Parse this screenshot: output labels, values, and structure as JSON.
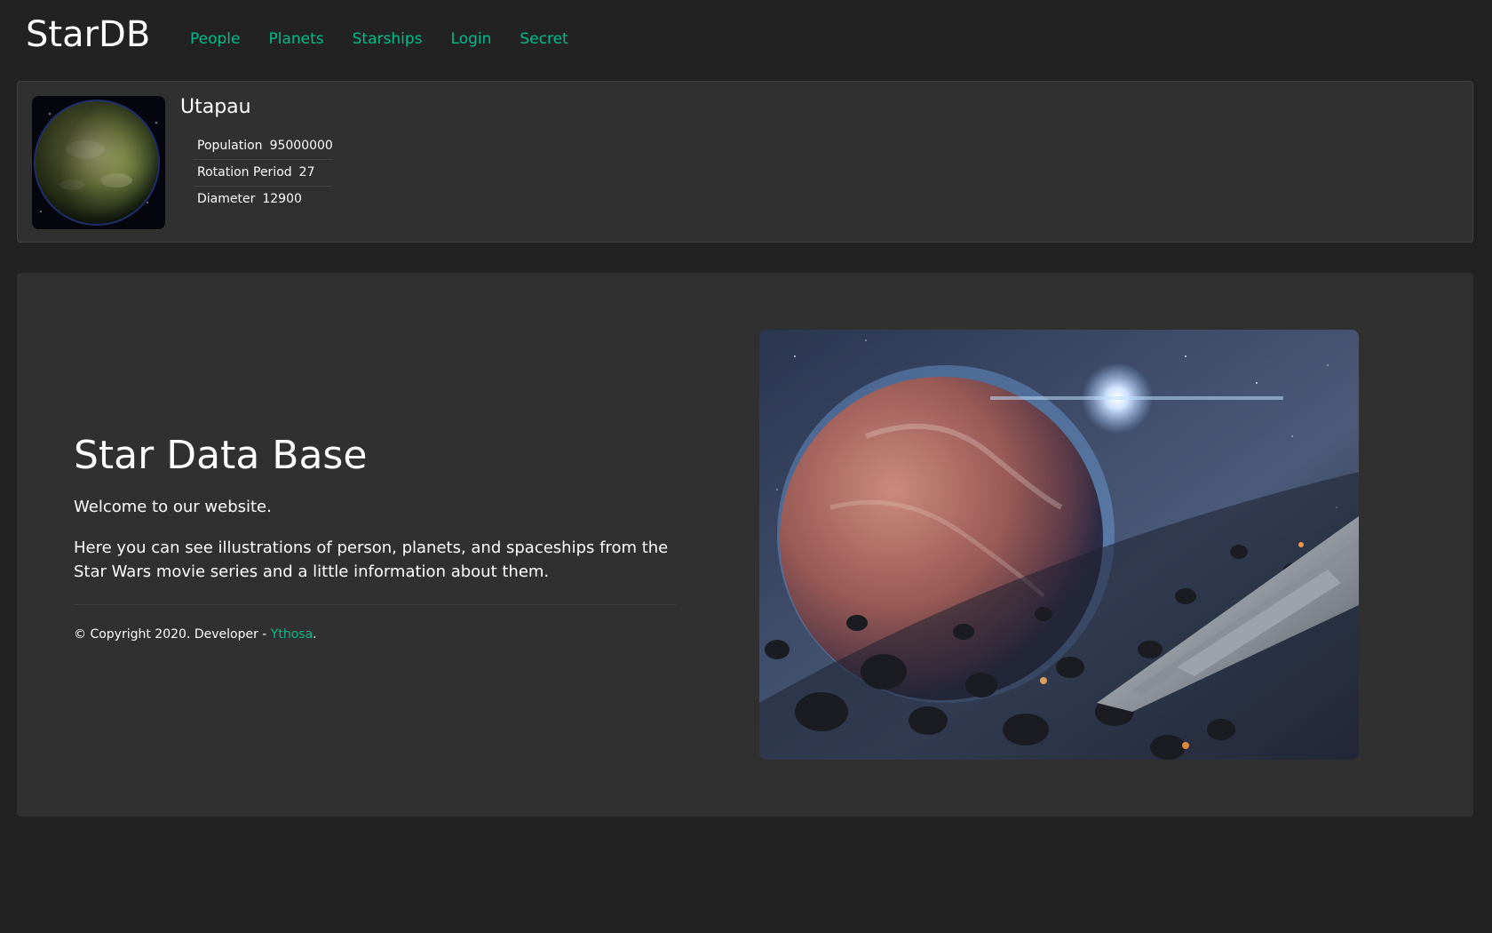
{
  "header": {
    "brand": "StarDB",
    "nav": [
      {
        "label": "People"
      },
      {
        "label": "Planets"
      },
      {
        "label": "Starships"
      },
      {
        "label": "Login"
      },
      {
        "label": "Secret"
      }
    ]
  },
  "planet": {
    "name": "Utapau",
    "image_alt": "planet",
    "details": [
      {
        "term": "Population",
        "value": "95000000"
      },
      {
        "term": "Rotation Period",
        "value": "27"
      },
      {
        "term": "Diameter",
        "value": "12900"
      }
    ]
  },
  "jumbotron": {
    "title": "Star Data Base",
    "welcome": "Welcome to our website.",
    "description": "Here you can see illustrations of person, planets, and spaceships from the Star Wars movie series and a little information about them.",
    "copyright_prefix": "© Copyright 2020. Developer - ",
    "developer_link": "Ythosa",
    "copyright_suffix": "."
  },
  "colors": {
    "background": "#222222",
    "card": "#303030",
    "accent": "#00bc8c",
    "text": "#ffffff"
  },
  "icons": {
    "planet_image": "planet-image",
    "hero_image": "space-scene-image"
  }
}
